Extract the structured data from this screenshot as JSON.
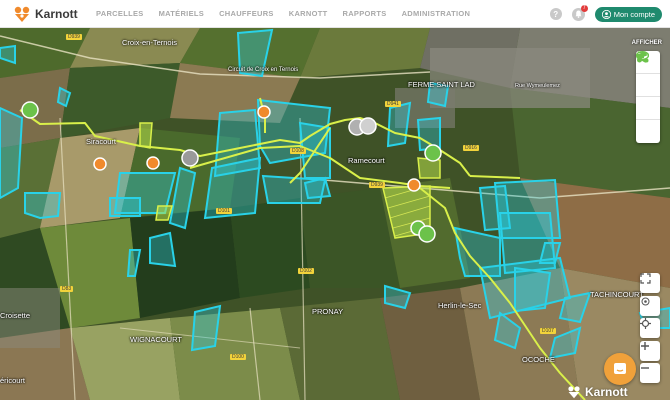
{
  "brand": {
    "name": "Karnott"
  },
  "nav": {
    "items": [
      "PARCELLES",
      "MATÉRIELS",
      "CHAUFFEURS",
      "KARNOTT",
      "RAPPORTS",
      "ADMINISTRATION"
    ]
  },
  "header_right": {
    "help_label": "?",
    "notification_count": "7",
    "account_label": "Mon compte"
  },
  "map": {
    "display_label": "AFFICHER",
    "places": {
      "croix": "Croix-en-Ternois",
      "circuit": "Circuit de Croix en Ternois",
      "ferme": "FERME SAINT LAD",
      "siracourt": "Siracourt",
      "ramecourt": "Ramecourt",
      "pronay": "PRONAY",
      "croisette": "Croisette",
      "wignacourt": "WIGNACOURT",
      "tachincourt": "TACHINCOURT",
      "ococh": "OCOCHE",
      "hernin": "Herlin-le-Sec",
      "ericourt": "éricourt",
      "rue": "Rue Wymeulemez"
    },
    "roads": {
      "d939a": "D939",
      "d939b": "D939",
      "d916": "D916",
      "d941": "D941",
      "d101": "D101",
      "d102": "D102",
      "d100": "D100",
      "d83": "D83",
      "d108": "D108",
      "d107": "D107"
    }
  },
  "colors": {
    "primary": "#1f8a6e",
    "parcel_cyan": "#29d2e8",
    "track_yellow": "#d9f04a",
    "marker_orange": "#f08a2c",
    "marker_green": "#6cc24a"
  },
  "watermark": {
    "name": "Karnott"
  }
}
